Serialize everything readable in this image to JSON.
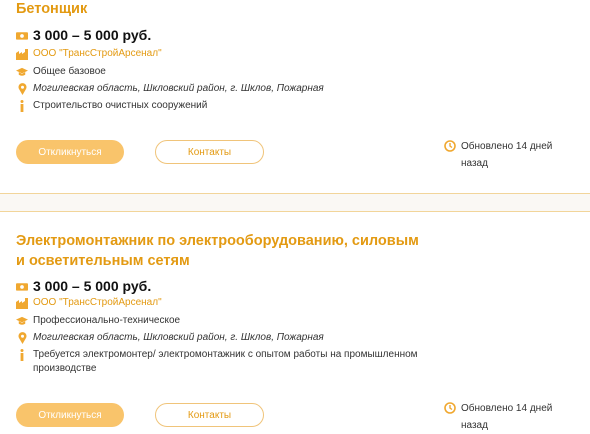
{
  "jobs": [
    {
      "title": "Бетонщик",
      "salary": "3 000 – 5 000 руб.",
      "company": "ООО \"ТрансСтройАрсенал\"",
      "education": "Общее базовое",
      "location": "Могилевская область, Шкловский район, г. Шклов, Пожарная",
      "description": "Строительство очистных сооружений",
      "apply_label": "Откликнуться",
      "contacts_label": "Контакты",
      "updated": "Обновлено 14 дней назад"
    },
    {
      "title": "Электромонтажник по электрооборудованию, силовым и осветительным сетям",
      "salary": "3 000 – 5 000 руб.",
      "company": "ООО \"ТрансСтройАрсенал\"",
      "education": "Профессионально-техническое",
      "location": "Могилевская область, Шкловский район, г. Шклов, Пожарная",
      "description": "Требуется электромонтер/ электромонтажник с опытом работы на промышленном производстве",
      "apply_label": "Откликнуться",
      "contacts_label": "Контакты",
      "updated": "Обновлено 14 дней назад"
    }
  ],
  "colors": {
    "accent": "#e39a12",
    "button_fill": "#f9c46b",
    "divider": "#f2d59a"
  },
  "icons": [
    "money-icon",
    "company-icon",
    "education-icon",
    "location-icon",
    "info-icon",
    "clock-icon"
  ]
}
